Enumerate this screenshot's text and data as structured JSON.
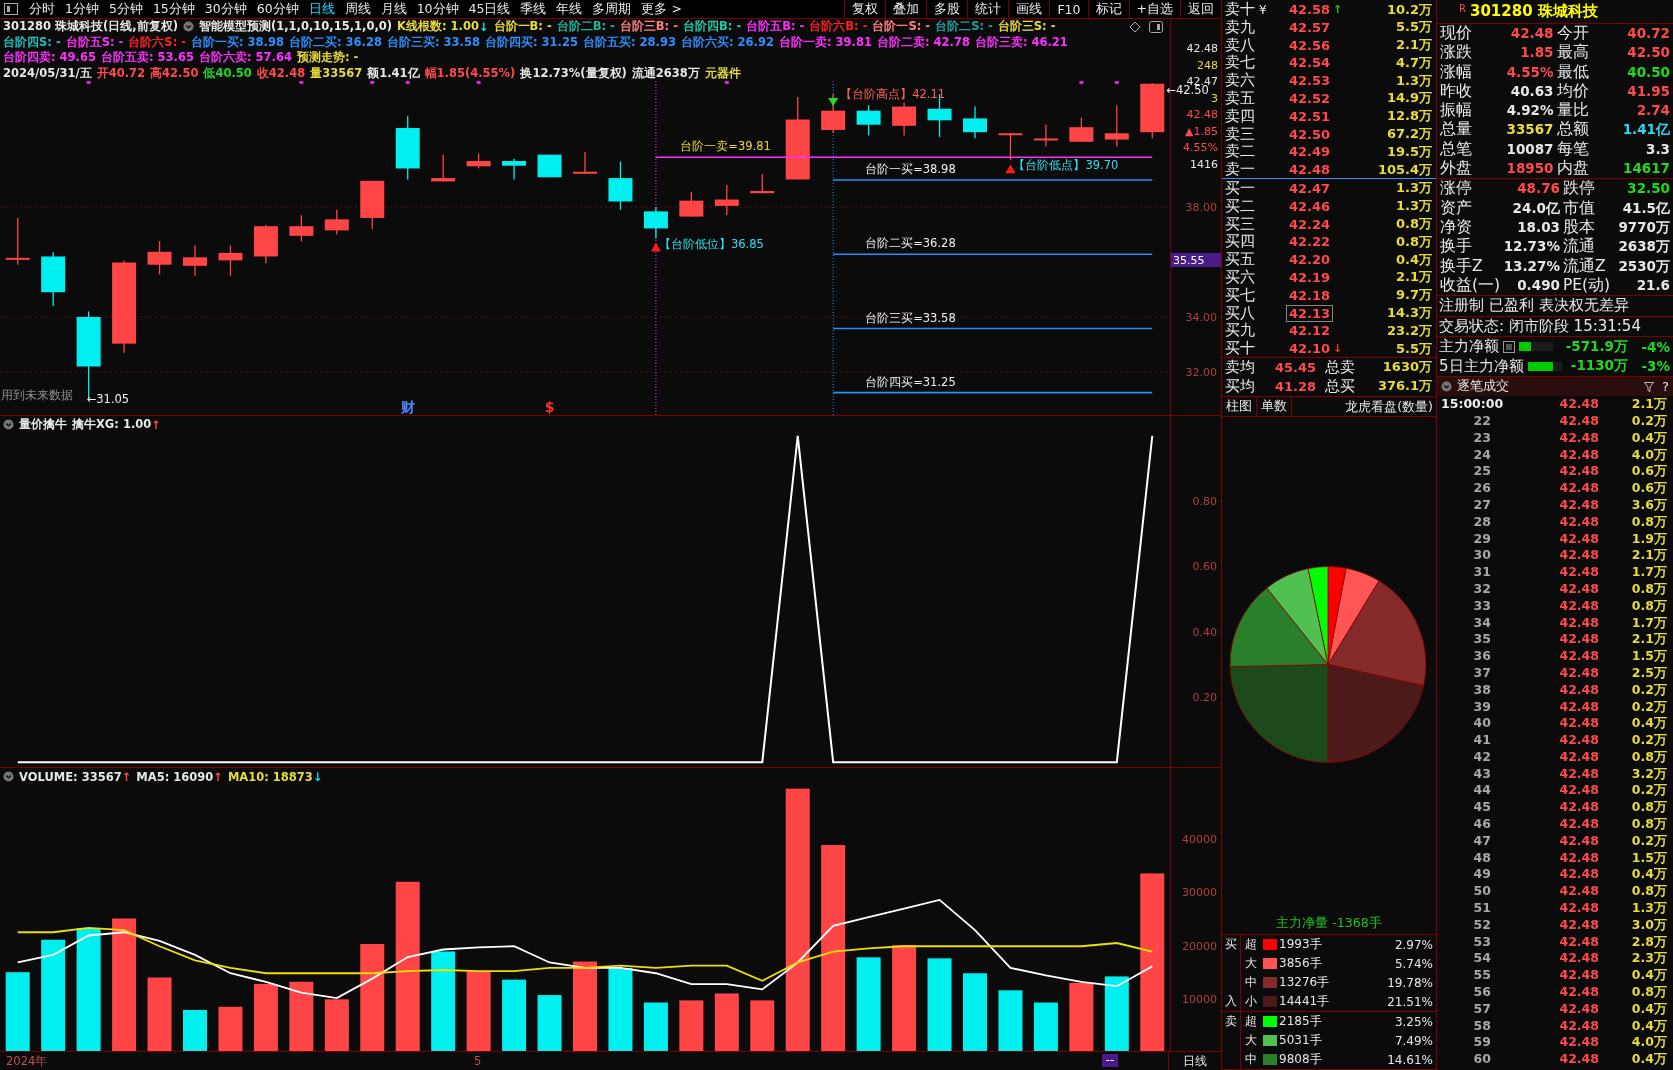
{
  "toolbar": {
    "tabs": [
      {
        "label": "分时",
        "selected": false
      },
      {
        "label": "1分钟",
        "selected": false
      },
      {
        "label": "5分钟",
        "selected": false
      },
      {
        "label": "15分钟",
        "selected": false
      },
      {
        "label": "30分钟",
        "selected": false
      },
      {
        "label": "60分钟",
        "selected": false
      },
      {
        "label": "日线",
        "selected": true
      },
      {
        "label": "周线",
        "selected": false
      },
      {
        "label": "月线",
        "selected": false
      },
      {
        "label": "10分钟",
        "selected": false
      },
      {
        "label": "45日线",
        "selected": false
      },
      {
        "label": "季线",
        "selected": false
      },
      {
        "label": "年线",
        "selected": false
      },
      {
        "label": "多周期",
        "selected": false
      },
      {
        "label": "更多 >",
        "selected": false
      }
    ],
    "buttons": [
      "复权",
      "叠加",
      "多股",
      "统计",
      "画线",
      "F10",
      "标记",
      "+自选",
      "返回"
    ]
  },
  "main": {
    "header": [
      [
        {
          "kind": "text",
          "text": "301280 珠城科技(日线,前复权)",
          "color": "#e8e8e8"
        },
        {
          "kind": "menu"
        },
        {
          "kind": "text",
          "text": "智能模型预测(1,1,0,10,15,1,0,0)",
          "color": "#e8e8e8"
        },
        {
          "kind": "text",
          "text": "K线根数: 1.00",
          "color": "#e8dc3a"
        },
        {
          "kind": "arrow",
          "text": "↓",
          "color": "#00e5ff"
        },
        {
          "kind": "text",
          "text": "台阶一B: -",
          "color": "#e8dc3a"
        },
        {
          "kind": "text",
          "text": "台阶二B: -",
          "color": "#1fb5a0"
        },
        {
          "kind": "text",
          "text": "台阶三B: -",
          "color": "#ff8080"
        },
        {
          "kind": "text",
          "text": "台阶四B: -",
          "color": "#20c8b0"
        },
        {
          "kind": "text",
          "text": "台阶五B: -",
          "color": "#ff30ff"
        },
        {
          "kind": "text",
          "text": "台阶六B: -",
          "color": "#ff2020"
        },
        {
          "kind": "text",
          "text": "台阶一S: -",
          "color": "#ff8080"
        },
        {
          "kind": "text",
          "text": "台阶二S: -",
          "color": "#1fa0a0"
        },
        {
          "kind": "text",
          "text": "台阶三S: -",
          "color": "#e8dc3a"
        }
      ],
      [
        {
          "kind": "text",
          "text": "台阶四S: -",
          "color": "#20c0c0"
        },
        {
          "kind": "text",
          "text": "台阶五S: -",
          "color": "#ff30ff"
        },
        {
          "kind": "text",
          "text": "台阶六S: -",
          "color": "#ff2020"
        },
        {
          "kind": "text",
          "text": "台阶一买: 38.98",
          "color": "#2e8fff"
        },
        {
          "kind": "text",
          "text": "台阶二买: 36.28",
          "color": "#2e8fff"
        },
        {
          "kind": "text",
          "text": "台阶三买: 33.58",
          "color": "#2e8fff"
        },
        {
          "kind": "text",
          "text": "台阶四买: 31.25",
          "color": "#2e8fff"
        },
        {
          "kind": "text",
          "text": "台阶五买: 28.93",
          "color": "#2e8fff"
        },
        {
          "kind": "text",
          "text": "台阶六买: 26.92",
          "color": "#2e8fff"
        },
        {
          "kind": "text",
          "text": "台阶一卖: 39.81",
          "color": "#ff30ff"
        },
        {
          "kind": "text",
          "text": "台阶二卖: 42.78",
          "color": "#ff30ff"
        },
        {
          "kind": "text",
          "text": "台阶三卖: 46.21",
          "color": "#ff30ff"
        }
      ],
      [
        {
          "kind": "text",
          "text": "台阶四卖: 49.65",
          "color": "#ff30ff"
        },
        {
          "kind": "text",
          "text": "台阶五卖: 53.65",
          "color": "#ff30ff"
        },
        {
          "kind": "text",
          "text": "台阶六卖: 57.64",
          "color": "#ff30ff"
        },
        {
          "kind": "text",
          "text": "预测走势: -",
          "color": "#e8dc3a"
        }
      ],
      [
        {
          "kind": "text",
          "text": "2024/05/31/五",
          "color": "#e8e8e8"
        },
        {
          "kind": "text",
          "text": "开40.72",
          "color": "#ff4a4a"
        },
        {
          "kind": "text",
          "text": "高42.50",
          "color": "#ff4a4a"
        },
        {
          "kind": "text",
          "text": "低40.50",
          "color": "#20d820"
        },
        {
          "kind": "text",
          "text": "收42.48",
          "color": "#ff4a4a"
        },
        {
          "kind": "text",
          "text": "量33567",
          "color": "#e8dc3a"
        },
        {
          "kind": "text",
          "text": "额1.41亿",
          "color": "#e8e8e8"
        },
        {
          "kind": "text",
          "text": "幅1.85(4.55%)",
          "color": "#ff4a4a"
        },
        {
          "kind": "text",
          "text": "换12.73%(量复权)",
          "color": "#e8e8e8"
        },
        {
          "kind": "text",
          "text": "流通2638万",
          "color": "#e8e8e8"
        },
        {
          "kind": "text",
          "text": "元器件",
          "color": "#e8dc3a"
        }
      ]
    ],
    "axis_info": [
      {
        "text": "42.48",
        "color": "#e8e8e8"
      },
      {
        "text": "248",
        "color": "#e8dc3a"
      },
      {
        "text": "42.47",
        "color": "#e8e8e8"
      },
      {
        "text": "3",
        "color": "#e8dc3a"
      },
      {
        "text": "42.48",
        "color": "#ff4a4a"
      },
      {
        "text": "▲1.85",
        "color": "#ff4a4a"
      },
      {
        "text": "4.55%",
        "color": "#ff4a4a"
      },
      {
        "text": "1416",
        "color": "#e8e8e8"
      }
    ],
    "cursor_price": "35.55",
    "footnote": "用到未来数据",
    "pointers": [
      {
        "text": "←42.50"
      },
      {
        "text": "←31.05"
      }
    ],
    "markers": [
      {
        "kind": "low",
        "text": "【台阶低位】36.85"
      },
      {
        "kind": "high",
        "text": "【台阶高点】42.11"
      },
      {
        "kind": "low",
        "text": "【台阶低点】39.70"
      }
    ],
    "notes": [
      {
        "text": "财",
        "color": "#4a8cff"
      },
      {
        "text": "$",
        "color": "#ff3030"
      }
    ],
    "chart_data": {
      "type": "candlestick",
      "grid": true,
      "ylim": [
        30.4,
        42.58
      ],
      "yticks": [
        {
          "value": 32,
          "label": "32.00"
        },
        {
          "value": 34,
          "label": "34.00"
        },
        {
          "value": 38,
          "label": "38.00"
        }
      ],
      "ohlc": [
        [
          36.1,
          37.6,
          35.9,
          36.15
        ],
        [
          36.2,
          36.35,
          34.4,
          34.9
        ],
        [
          34.0,
          34.2,
          31.05,
          32.2
        ],
        [
          33.03,
          36.05,
          32.7,
          35.98
        ],
        [
          35.9,
          36.76,
          35.55,
          36.37
        ],
        [
          35.86,
          36.6,
          35.5,
          36.17
        ],
        [
          36.06,
          36.6,
          35.5,
          36.33
        ],
        [
          36.2,
          37.35,
          35.95,
          37.3
        ],
        [
          36.95,
          37.7,
          36.75,
          37.3
        ],
        [
          37.15,
          37.9,
          37.0,
          37.55
        ],
        [
          37.6,
          38.95,
          37.2,
          38.95
        ],
        [
          40.87,
          41.3,
          39.0,
          39.4
        ],
        [
          38.93,
          39.9,
          38.93,
          39.05
        ],
        [
          39.48,
          39.95,
          39.4,
          39.67
        ],
        [
          39.67,
          39.75,
          39.0,
          39.5
        ],
        [
          39.9,
          39.9,
          39.08,
          39.08
        ],
        [
          39.24,
          40.0,
          39.24,
          39.28
        ],
        [
          39.05,
          39.65,
          37.9,
          38.2
        ],
        [
          37.84,
          38.0,
          36.85,
          37.22
        ],
        [
          37.65,
          38.55,
          37.65,
          38.23
        ],
        [
          38.04,
          38.8,
          37.7,
          38.27
        ],
        [
          38.5,
          39.2,
          38.5,
          38.58
        ],
        [
          39.0,
          42.0,
          39.0,
          41.18
        ],
        [
          40.8,
          42.11,
          40.7,
          41.5
        ],
        [
          41.5,
          41.7,
          40.6,
          40.99
        ],
        [
          40.95,
          41.8,
          40.6,
          41.65
        ],
        [
          41.57,
          42.1,
          40.55,
          41.15
        ],
        [
          41.22,
          41.65,
          40.5,
          40.72
        ],
        [
          40.64,
          40.7,
          39.7,
          40.68
        ],
        [
          40.45,
          41.0,
          40.2,
          40.49
        ],
        [
          40.37,
          41.25,
          40.37,
          40.9
        ],
        [
          40.45,
          41.7,
          40.2,
          40.68
        ],
        [
          40.72,
          42.5,
          40.5,
          42.48
        ]
      ],
      "ref_lines": [
        {
          "axis": "y",
          "value": 39.81,
          "label": "台阶一卖=39.81",
          "color": "#ff30ff"
        },
        {
          "axis": "y",
          "value": 38.98,
          "label": "台阶一买=38.98",
          "color": "#1e90ff"
        },
        {
          "axis": "y",
          "value": 36.28,
          "label": "台阶二买=36.28",
          "color": "#1e90ff"
        },
        {
          "axis": "y",
          "value": 33.58,
          "label": "台阶三买=33.58",
          "color": "#1e90ff"
        },
        {
          "axis": "y",
          "value": 31.25,
          "label": "台阶四买=31.25",
          "color": "#1e90ff"
        }
      ]
    }
  },
  "indicator": {
    "header": [
      {
        "kind": "menu"
      },
      {
        "kind": "text",
        "text": "量价擒牛",
        "color": "#e8e8e8"
      },
      {
        "kind": "text",
        "text": "擒牛XG: 1.00",
        "color": "#e8e8e8"
      },
      {
        "kind": "arrow",
        "text": "↑",
        "color": "#ff4a4a"
      }
    ],
    "chart_data": {
      "type": "line",
      "yticks": [
        {
          "value": 0.2,
          "label": "0.20"
        },
        {
          "value": 0.4,
          "label": "0.40"
        },
        {
          "value": 0.6,
          "label": "0.60"
        },
        {
          "value": 0.8,
          "label": "0.80"
        }
      ],
      "ylim": [
        -0.018,
        1.006
      ],
      "series": [
        {
          "color": "#ffffff",
          "values": [
            0,
            0,
            0,
            0,
            0,
            0,
            0,
            0,
            0,
            0,
            0,
            0,
            0,
            0,
            0,
            0,
            0,
            0,
            0,
            0,
            0,
            0,
            1,
            0,
            0,
            0,
            0,
            0,
            0,
            0,
            0,
            0,
            1
          ]
        }
      ]
    }
  },
  "volume": {
    "header": [
      {
        "kind": "menu"
      },
      {
        "kind": "text",
        "text": "VOLUME: 33567",
        "color": "#e8e8e8"
      },
      {
        "kind": "arrow",
        "text": "↑",
        "color": "#ff4a4a"
      },
      {
        "kind": "text",
        "text": "MA5: 16090",
        "color": "#e8e8e8"
      },
      {
        "kind": "arrow",
        "text": "↑",
        "color": "#ff4a4a"
      },
      {
        "kind": "text",
        "text": "MA10: 18873",
        "color": "#e8dc3a"
      },
      {
        "kind": "arrow",
        "text": "↓",
        "color": "#00e5ff"
      }
    ],
    "chart_data": {
      "type": "bar",
      "yticks": [
        10000,
        30000
      ],
      "ylim": [
        0,
        50000
      ],
      "values": [
        15000,
        21100,
        23300,
        25100,
        14000,
        7900,
        8500,
        12800,
        13200,
        9900,
        20300,
        32000,
        18900,
        15200,
        13600,
        10700,
        17000,
        15800,
        9300,
        9700,
        11000,
        9700,
        49500,
        38900,
        17800,
        20100,
        17600,
        14800,
        11600,
        9300,
        13000,
        14200,
        33567
      ]
    },
    "averages": {
      "chart_data": {
        "type": "line",
        "yticks": [
          20000,
          40000
        ],
        "ylim": [
          0,
          50000
        ],
        "series": [
          {
            "color": "#ffffff",
            "values": [
              16832,
              18252,
              21902,
              22511,
              20888,
              18252,
              14804,
              13182,
              11154,
              10140,
              13790,
              17846,
              19266,
              19672,
              19874,
              16832,
              15818,
              15818,
              14804,
              12776,
              12776,
              11762,
              16832,
              23728,
              25350,
              26972,
              28595,
              22916,
              15818,
              14399,
              13182,
              12371,
              16090
            ]
          },
          {
            "color": "#f0e000",
            "values": [
              22511,
              22511,
              23322,
              22916,
              19874,
              17238,
              15818,
              14804,
              14804,
              14804,
              14804,
              15210,
              15413,
              15210,
              15210,
              15818,
              15818,
              16224,
              15818,
              16224,
              16224,
              13385,
              16832,
              18860,
              19469,
              19874,
              19874,
              19874,
              19874,
              19874,
              19874,
              20483,
              18873
            ]
          }
        ]
      }
    },
    "dates": [
      "2024年",
      "5"
    ],
    "marker": "--",
    "period": "日线"
  },
  "order_book": {
    "asks": [
      {
        "label": "卖十",
        "badge": "¥",
        "price": "42.58",
        "flag": "↑",
        "color": "#20c020",
        "volume": "10.2万",
        "selected": false
      },
      {
        "label": "卖九",
        "price": "42.57",
        "volume": "5.5万",
        "selected": false
      },
      {
        "label": "卖八",
        "price": "42.56",
        "volume": "2.1万",
        "selected": false
      },
      {
        "label": "卖七",
        "price": "42.54",
        "volume": "4.7万",
        "selected": false
      },
      {
        "label": "卖六",
        "price": "42.53",
        "volume": "1.3万",
        "selected": false
      },
      {
        "label": "卖五",
        "price": "42.52",
        "volume": "14.9万",
        "selected": false
      },
      {
        "label": "卖四",
        "price": "42.51",
        "volume": "12.8万",
        "selected": false
      },
      {
        "label": "卖三",
        "price": "42.50",
        "volume": "67.2万",
        "selected": false
      },
      {
        "label": "卖二",
        "price": "42.49",
        "volume": "19.5万",
        "selected": false
      },
      {
        "label": "卖一",
        "price": "42.48",
        "volume": "105.4万",
        "selected": false
      }
    ],
    "bids": [
      {
        "label": "买一",
        "price": "42.47",
        "volume": "1.3万",
        "selected": false
      },
      {
        "label": "买二",
        "price": "42.46",
        "volume": "1.3万",
        "selected": false
      },
      {
        "label": "买三",
        "price": "42.24",
        "volume": "0.8万",
        "selected": false
      },
      {
        "label": "买四",
        "price": "42.22",
        "volume": "0.8万",
        "selected": false
      },
      {
        "label": "买五",
        "price": "42.20",
        "volume": "0.4万",
        "selected": false
      },
      {
        "label": "买六",
        "price": "42.19",
        "volume": "2.1万",
        "selected": false
      },
      {
        "label": "买七",
        "price": "42.18",
        "volume": "9.7万",
        "selected": false
      },
      {
        "label": "买八",
        "price": "42.13",
        "volume": "14.3万",
        "selected": true
      },
      {
        "label": "买九",
        "price": "42.12",
        "volume": "23.2万",
        "selected": false
      },
      {
        "label": "买十",
        "price": "42.10",
        "flag": "↓",
        "color": "#ff3030",
        "volume": "5.5万",
        "selected": false
      }
    ],
    "summary": [
      {
        "label": "卖均",
        "price": "45.45",
        "label2": "总卖",
        "total": "1630万"
      },
      {
        "label": "买均",
        "price": "41.28",
        "label2": "总买",
        "total": "376.1万"
      }
    ],
    "tabs": [
      "柱图",
      "单数"
    ],
    "tab_title": "龙虎看盘(数量)",
    "pie": {
      "chart_data": {
        "type": "pie",
        "values": [
          2.97,
          5.74,
          19.78,
          21.51,
          24.65,
          14.61,
          7.49,
          3.25
        ]
      },
      "slices": [
        {
          "color": "#ff0000"
        },
        {
          "color": "#ff5555"
        },
        {
          "color": "#852a2a"
        },
        {
          "color": "#4d1a1a"
        },
        {
          "color": "#1c4a1c"
        },
        {
          "color": "#2a802a"
        },
        {
          "color": "#50c050"
        },
        {
          "color": "#00ff00"
        }
      ]
    },
    "net": "主力净量 -1368手",
    "legend": [
      {
        "side": [
          "买",
          "入"
        ],
        "rows": [
          {
            "size": "超",
            "hands": "1993手",
            "pct": "2.97%",
            "color": "#ff0000"
          },
          {
            "size": "大",
            "hands": "3856手",
            "pct": "5.74%",
            "color": "#ff5555"
          },
          {
            "size": "中",
            "hands": "13276手",
            "pct": "19.78%",
            "color": "#852a2a"
          },
          {
            "size": "小",
            "hands": "14441手",
            "pct": "21.51%",
            "color": "#4d1a1a"
          }
        ]
      },
      {
        "side": [
          "卖"
        ],
        "rows": [
          {
            "size": "超",
            "hands": "2185手",
            "pct": "3.25%",
            "color": "#00ff00"
          },
          {
            "size": "大",
            "hands": "5031手",
            "pct": "7.49%",
            "color": "#50c050"
          },
          {
            "size": "中",
            "hands": "9808手",
            "pct": "14.61%",
            "color": "#2a802a"
          }
        ]
      }
    ]
  },
  "quote": {
    "mark": "R",
    "title": "301280 珠城科技",
    "groups": [
      [
        {
          "cells": [
            {
              "label": "现价",
              "value": "42.48",
              "color": "#ff4a4a"
            },
            {
              "label": "今开",
              "value": "40.72",
              "color": "#ff4a4a"
            }
          ]
        },
        {
          "cells": [
            {
              "label": "涨跌",
              "value": "1.85",
              "color": "#ff4a4a"
            },
            {
              "label": "最高",
              "value": "42.50",
              "color": "#ff4a4a"
            }
          ]
        },
        {
          "cells": [
            {
              "label": "涨幅",
              "value": "4.55%",
              "color": "#ff4a4a"
            },
            {
              "label": "最低",
              "value": "40.50",
              "color": "#20d820"
            }
          ]
        },
        {
          "cells": [
            {
              "label": "昨收",
              "value": "40.63",
              "color": "#e8e8e8"
            },
            {
              "label": "均价",
              "value": "41.95",
              "color": "#ff4a4a"
            }
          ]
        },
        {
          "cells": [
            {
              "label": "振幅",
              "value": "4.92%",
              "color": "#e8e8e8"
            },
            {
              "label": "量比",
              "value": "2.74",
              "color": "#ff4a4a"
            }
          ]
        },
        {
          "cells": [
            {
              "label": "总量",
              "value": "33567",
              "color": "#e8dc3a"
            },
            {
              "label": "总额",
              "value": "1.41亿",
              "color": "#30d8f0"
            }
          ]
        },
        {
          "cells": [
            {
              "label": "总笔",
              "value": "10087",
              "color": "#e8e8e8"
            },
            {
              "label": "每笔",
              "value": "3.3",
              "color": "#e8e8e8"
            }
          ]
        },
        {
          "cells": [
            {
              "label": "外盘",
              "value": "18950",
              "color": "#ff4a4a"
            },
            {
              "label": "内盘",
              "value": "14617",
              "color": "#20d820"
            }
          ]
        }
      ],
      [
        {
          "cells": [
            {
              "label": "涨停",
              "value": "48.76",
              "color": "#ff4a4a"
            },
            {
              "label": "跌停",
              "value": "32.50",
              "color": "#20d820"
            }
          ]
        },
        {
          "cells": [
            {
              "label": "资产",
              "value": "24.0亿",
              "color": "#e8e8e8"
            },
            {
              "label": "市值",
              "value": "41.5亿",
              "color": "#e8e8e8"
            }
          ]
        },
        {
          "cells": [
            {
              "label": "净资",
              "value": "18.03",
              "color": "#e8e8e8"
            },
            {
              "label": "股本",
              "value": "9770万",
              "color": "#e8e8e8"
            }
          ]
        },
        {
          "cells": [
            {
              "label": "换手",
              "value": "12.73%",
              "color": "#e8e8e8"
            },
            {
              "label": "流通",
              "value": "2638万",
              "color": "#e8e8e8"
            }
          ]
        },
        {
          "cells": [
            {
              "label": "换手Z",
              "value": "13.27%",
              "color": "#e8e8e8"
            },
            {
              "label": "流通Z",
              "value": "2530万",
              "color": "#e8e8e8"
            }
          ]
        },
        {
          "cells": [
            {
              "label": "收益(一)",
              "value": "0.490",
              "color": "#e8e8e8"
            },
            {
              "label": "PE(动)",
              "value": "21.6",
              "color": "#e8e8e8"
            }
          ]
        }
      ]
    ],
    "tags": "注册制 已盈利 表决权无差异",
    "status": "交易状态: 闭市阶段 15:31:54",
    "flows": [
      {
        "label": "主力净额",
        "detail_icon": true,
        "level": 0.35,
        "value": "-571.9万",
        "pct": "-4%"
      },
      {
        "label": "5日主力净额",
        "detail_icon": false,
        "level": 0.75,
        "value": "-1130万",
        "pct": "-3%"
      }
    ]
  },
  "trades": {
    "title": "逐笔成交",
    "help": "?",
    "rows": [
      {
        "time": "15:00:00",
        "price": "42.48",
        "volume": "2.1万"
      },
      {
        "time": "22",
        "price": "42.48",
        "volume": "0.2万"
      },
      {
        "time": "23",
        "price": "42.48",
        "volume": "0.4万"
      },
      {
        "time": "24",
        "price": "42.48",
        "volume": "4.0万"
      },
      {
        "time": "25",
        "price": "42.48",
        "volume": "0.6万"
      },
      {
        "time": "26",
        "price": "42.48",
        "volume": "0.6万"
      },
      {
        "time": "27",
        "price": "42.48",
        "volume": "3.6万"
      },
      {
        "time": "28",
        "price": "42.48",
        "volume": "0.8万"
      },
      {
        "time": "29",
        "price": "42.48",
        "volume": "1.9万"
      },
      {
        "time": "30",
        "price": "42.48",
        "volume": "2.1万"
      },
      {
        "time": "31",
        "price": "42.48",
        "volume": "1.7万"
      },
      {
        "time": "32",
        "price": "42.48",
        "volume": "0.8万"
      },
      {
        "time": "33",
        "price": "42.48",
        "volume": "0.8万"
      },
      {
        "time": "34",
        "price": "42.48",
        "volume": "1.7万"
      },
      {
        "time": "35",
        "price": "42.48",
        "volume": "2.1万"
      },
      {
        "time": "36",
        "price": "42.48",
        "volume": "1.5万"
      },
      {
        "time": "37",
        "price": "42.48",
        "volume": "2.5万"
      },
      {
        "time": "38",
        "price": "42.48",
        "volume": "0.2万"
      },
      {
        "time": "39",
        "price": "42.48",
        "volume": "0.2万"
      },
      {
        "time": "40",
        "price": "42.48",
        "volume": "0.4万"
      },
      {
        "time": "41",
        "price": "42.48",
        "volume": "0.2万"
      },
      {
        "time": "42",
        "price": "42.48",
        "volume": "0.8万"
      },
      {
        "time": "43",
        "price": "42.48",
        "volume": "3.2万"
      },
      {
        "time": "44",
        "price": "42.48",
        "volume": "0.2万"
      },
      {
        "time": "45",
        "price": "42.48",
        "volume": "0.8万"
      },
      {
        "time": "46",
        "price": "42.48",
        "volume": "0.8万"
      },
      {
        "time": "47",
        "price": "42.48",
        "volume": "0.2万"
      },
      {
        "time": "48",
        "price": "42.48",
        "volume": "1.5万"
      },
      {
        "time": "49",
        "price": "42.48",
        "volume": "0.4万"
      },
      {
        "time": "50",
        "price": "42.48",
        "volume": "0.8万"
      },
      {
        "time": "51",
        "price": "42.48",
        "volume": "1.3万"
      },
      {
        "time": "52",
        "price": "42.48",
        "volume": "3.0万"
      },
      {
        "time": "53",
        "price": "42.48",
        "volume": "2.8万"
      },
      {
        "time": "54",
        "price": "42.48",
        "volume": "2.3万"
      },
      {
        "time": "55",
        "price": "42.48",
        "volume": "0.4万"
      },
      {
        "time": "56",
        "price": "42.48",
        "volume": "0.8万"
      },
      {
        "time": "57",
        "price": "42.48",
        "volume": "0.4万"
      },
      {
        "time": "58",
        "price": "42.48",
        "volume": "0.4万"
      },
      {
        "time": "59",
        "price": "42.48",
        "volume": "4.0万"
      },
      {
        "time": "60",
        "price": "42.48",
        "volume": "0.4万"
      }
    ]
  }
}
